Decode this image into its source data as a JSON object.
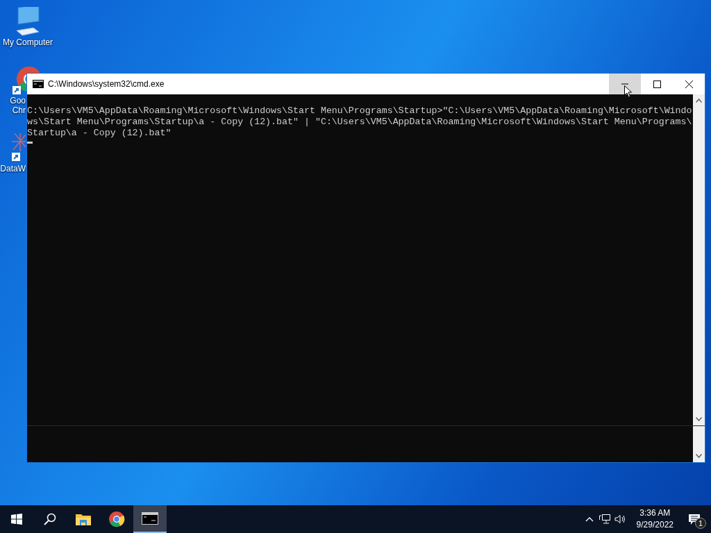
{
  "desktop_icons": [
    {
      "kind": "computer",
      "lines": [
        "My Computer"
      ]
    },
    {
      "kind": "chrome",
      "lines": [
        "Goo",
        "Chr"
      ]
    },
    {
      "kind": "data",
      "lines": [
        "DataW"
      ]
    }
  ],
  "window": {
    "title": "C:\\Windows\\system32\\cmd.exe",
    "controls": [
      {
        "kind": "minimize",
        "hovered": true
      },
      {
        "kind": "maximize",
        "hovered": false
      },
      {
        "kind": "close",
        "hovered": false
      }
    ],
    "console_lines": [
      "C:\\Users\\VM5\\AppData\\Roaming\\Microsoft\\Windows\\Start Menu\\Programs\\Startup>\"C:\\Users\\VM5\\AppData\\Roaming\\Microsoft\\Windo",
      "ws\\Start Menu\\Programs\\Startup\\a - Copy (12).bat\" | \"C:\\Users\\VM5\\AppData\\Roaming\\Microsoft\\Windows\\Start Menu\\Programs\\",
      "Startup\\a - Copy (12).bat\""
    ]
  },
  "taskbar": {
    "apps": [
      {
        "kind": "start",
        "selected": false
      },
      {
        "kind": "search",
        "selected": false
      },
      {
        "kind": "explorer",
        "selected": false
      },
      {
        "kind": "chrome",
        "selected": false
      },
      {
        "kind": "cmd",
        "selected": true
      }
    ],
    "clock": {
      "time": "3:36 AM",
      "date": "9/29/2022"
    },
    "notifications": {
      "count": "1"
    }
  }
}
